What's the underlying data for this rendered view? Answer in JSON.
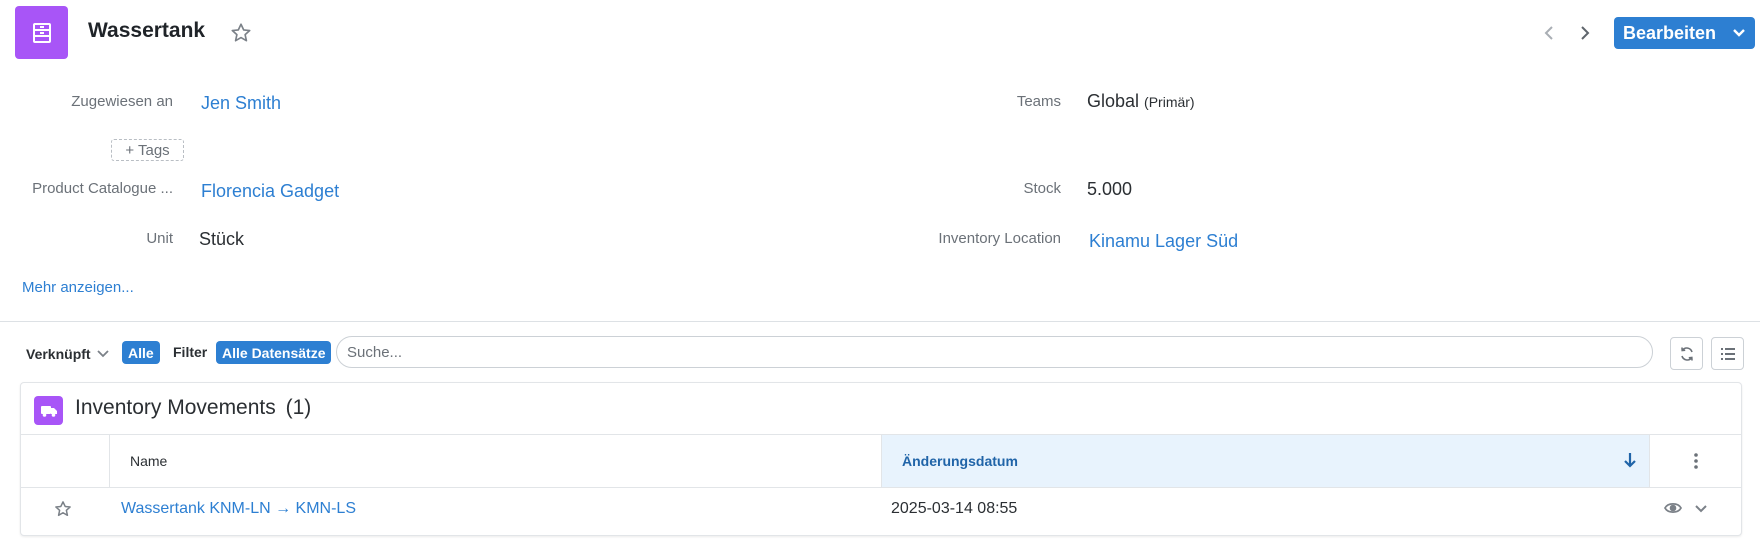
{
  "header": {
    "title": "Wassertank",
    "edit_label": "Bearbeiten",
    "record_icon": "inventory-rack-icon"
  },
  "fields": {
    "assigned": {
      "label": "Zugewiesen an",
      "value": "Jen Smith"
    },
    "teams": {
      "label": "Teams",
      "value": "Global",
      "note": "(Primär)"
    },
    "tags": {
      "label": "+ Tags"
    },
    "product": {
      "label": "Product Catalogue ...",
      "value": "Florencia Gadget"
    },
    "stock": {
      "label": "Stock",
      "value": "5.000"
    },
    "unit": {
      "label": "Unit",
      "value": "Stück"
    },
    "location": {
      "label": "Inventory Location",
      "value": "Kinamu Lager Süd"
    },
    "more": "Mehr anzeigen..."
  },
  "toolbar": {
    "linked": "Verknüpft",
    "all": "Alle",
    "filter": "Filter",
    "all_records": "Alle Datensätze",
    "search_placeholder": "Suche..."
  },
  "panel": {
    "title": "Inventory Movements",
    "count": "(1)",
    "columns": {
      "name": "Name",
      "date": "Änderungsdatum"
    },
    "rows": [
      {
        "name": "Wassertank KNM-LN → KMN-LS",
        "date": "2025-03-14 08:55"
      }
    ]
  },
  "colors": {
    "accent": "#2d7fd2",
    "module": "#a855f7",
    "sorted_header_bg": "#e8f3fd"
  }
}
